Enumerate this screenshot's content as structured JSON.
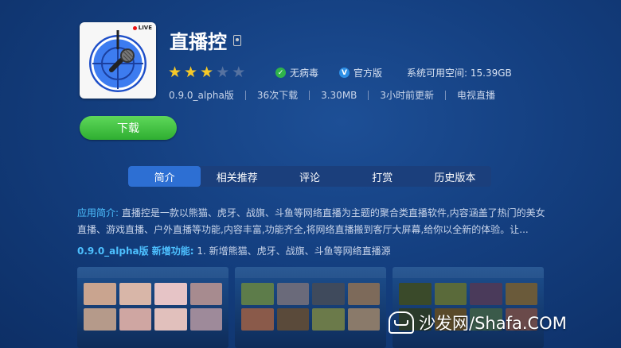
{
  "app": {
    "name": "直播控",
    "icon_badge": "LIVE",
    "rating": 3,
    "rating_max": 5,
    "badges": [
      {
        "icon": "check-circle-icon",
        "label": "无病毒"
      },
      {
        "icon": "v-verified-icon",
        "label": "官方版"
      }
    ],
    "storage": "系统可用空间: 15.39GB",
    "meta": [
      "0.9.0_alpha版",
      "36次下载",
      "3.30MB",
      "3小时前更新",
      "电视直播"
    ]
  },
  "actions": {
    "download_label": "下载"
  },
  "tabs": [
    {
      "label": "简介",
      "active": true
    },
    {
      "label": "相关推荐",
      "active": false
    },
    {
      "label": "评论",
      "active": false
    },
    {
      "label": "打赏",
      "active": false
    },
    {
      "label": "历史版本",
      "active": false
    }
  ],
  "description": {
    "label": "应用简介:",
    "text": " 直播控是一款以熊猫、虎牙、战旗、斗鱼等网络直播为主题的聚合类直播软件,内容涵盖了热门的美女直播、游戏直播、户外直播等功能,内容丰富,功能齐全,将网络直播搬到客厅大屏幕,给你以全新的体验。让..."
  },
  "new_features": {
    "label": "0.9.0_alpha版 新增功能:",
    "text": " 1. 新增熊猫、虎牙、战旗、斗鱼等网络直播源"
  },
  "watermark": "沙发网/Shafa.COM",
  "colors": {
    "accent_blue": "#2d6fd3",
    "download_green": "#3fbf3f",
    "star_gold": "#f6c928",
    "label_cyan": "#4dc0ff"
  }
}
